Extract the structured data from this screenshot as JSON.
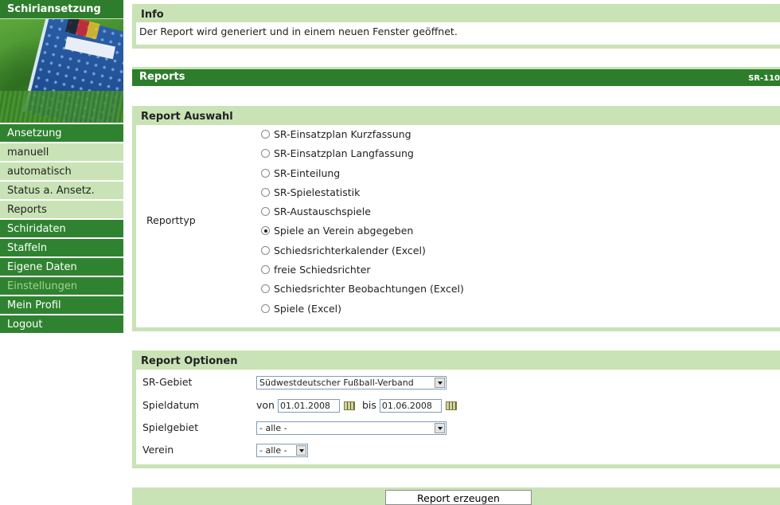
{
  "sidebar": {
    "title": "Schiriansetzung",
    "items": [
      {
        "label": "Ansetzung",
        "style": "dark"
      },
      {
        "label": "manuell",
        "style": "light"
      },
      {
        "label": "automatisch",
        "style": "light"
      },
      {
        "label": "Status a. Ansetz.",
        "style": "light"
      },
      {
        "label": "Reports",
        "style": "light"
      },
      {
        "label": "Schiridaten",
        "style": "dark"
      },
      {
        "label": "Staffeln",
        "style": "dark"
      },
      {
        "label": "Eigene Daten",
        "style": "dark"
      },
      {
        "label": "Einstellungen",
        "style": "disabled"
      },
      {
        "label": "Mein Profil",
        "style": "dark"
      },
      {
        "label": "Logout",
        "style": "dark"
      }
    ]
  },
  "info": {
    "title": "Info",
    "message": "Der Report wird generiert und in einem neuen Fenster geöffnet."
  },
  "reports_bar": {
    "title": "Reports",
    "code": "SR-110"
  },
  "auswahl": {
    "title": "Report Auswahl",
    "field_label": "Reporttyp",
    "options": [
      {
        "label": "SR-Einsatzplan Kurzfassung",
        "checked": false
      },
      {
        "label": "SR-Einsatzplan Langfassung",
        "checked": false
      },
      {
        "label": "SR-Einteilung",
        "checked": false
      },
      {
        "label": "SR-Spielestatistik",
        "checked": false
      },
      {
        "label": "SR-Austauschspiele",
        "checked": false
      },
      {
        "label": "Spiele an Verein abgegeben",
        "checked": true
      },
      {
        "label": "Schiedsrichterkalender (Excel)",
        "checked": false
      },
      {
        "label": "freie Schiedsrichter",
        "checked": false
      },
      {
        "label": "Schiedsrichter Beobachtungen (Excel)",
        "checked": false
      },
      {
        "label": "Spiele (Excel)",
        "checked": false
      }
    ]
  },
  "optionen": {
    "title": "Report Optionen",
    "sr_gebiet": {
      "label": "SR-Gebiet",
      "value": "Südwestdeutscher Fußball-Verband"
    },
    "spieldatum": {
      "label": "Spieldatum",
      "von_label": "von",
      "von": "01.01.2008",
      "bis_label": "bis",
      "bis": "01.06.2008"
    },
    "spielgebiet": {
      "label": "Spielgebiet",
      "value": "- alle -"
    },
    "verein": {
      "label": "Verein",
      "value": "- alle -"
    }
  },
  "submit_label": "Report erzeugen",
  "colors": {
    "dark_green": "#2e7d2c",
    "light_green": "#c9e3b6"
  }
}
